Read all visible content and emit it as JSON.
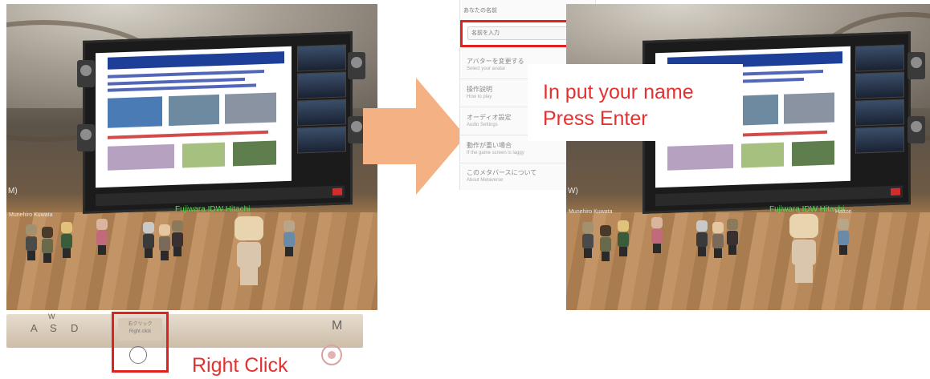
{
  "left_scene": {
    "screen_caption": "Fujiwara IDW Hitachi",
    "side_letter": "M)",
    "nametags": [
      "Munehiro Kuwata"
    ]
  },
  "keyboard": {
    "keys": [
      "A",
      "S",
      "D"
    ],
    "key_w": "W",
    "key_m": "M",
    "right_click_slot_text": "右クリック",
    "right_click_slot_sub": "Right click"
  },
  "annotations": {
    "right_click": "Right Click",
    "input_instruction_line1": "In put your name",
    "input_instruction_line2": "Press Enter"
  },
  "settings_menu": {
    "header": "あなたの名前",
    "name_placeholder": "名前を入力",
    "items": [
      {
        "title": "アバターを変更する",
        "sub": "Select your avatar"
      },
      {
        "title": "操作説明",
        "sub": "How to play"
      },
      {
        "title": "オーディオ設定",
        "sub": "Audio Settings"
      },
      {
        "title": "動作が重い場合",
        "sub": "If the game screen is laggy"
      },
      {
        "title": "このメタバースについて",
        "sub": "About Metaverse"
      }
    ]
  },
  "right_scene": {
    "screen_caption": "Fujiwara IDW Hitachi",
    "side_letter": "W)",
    "nametags": [
      "Munehiro Kuwata",
      "Hattori"
    ]
  },
  "colors": {
    "highlight_red": "#e02121",
    "annotation_red": "#e53030",
    "arrow": "#f4b183",
    "caption_green": "#52e04f"
  }
}
